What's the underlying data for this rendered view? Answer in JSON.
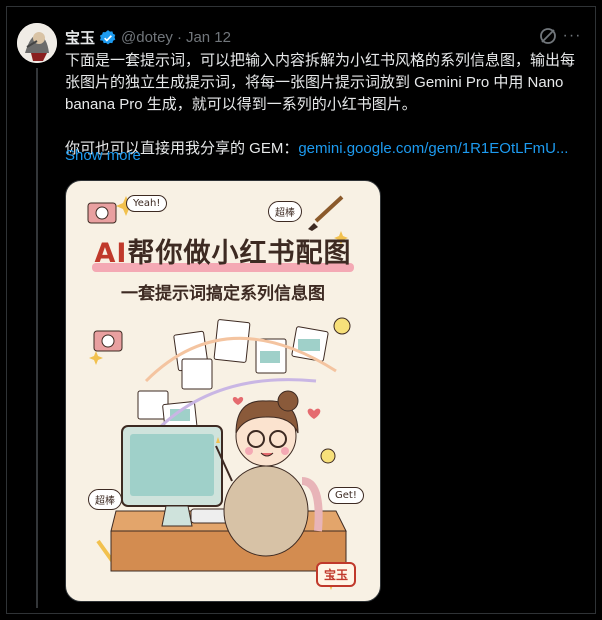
{
  "author": {
    "name": "宝玉",
    "handle": "@dotey",
    "separator": "·",
    "date": "Jan 12"
  },
  "tweet": {
    "para1": "下面是一套提示词，可以把输入内容拆解为小红书风格的系列信息图，输出每张图片的独立生成提示词，将每一张图片提示词放到 Gemini Pro 中用 Nano banana Pro 生成，就可以得到一系列的小红书图片。",
    "para2_prefix": "你可也可以直接用我分享的 GEM：",
    "link": "gemini.google.com/gem/1R1EOtLFmU...",
    "show_more": "Show more"
  },
  "media": {
    "title_ai": "AI",
    "title_rest": "帮你做小红书配图",
    "subtitle": "一套提示词搞定系列信息图",
    "bubble_yeah": "Yeah!",
    "bubble_chaobang_top": "超棒",
    "bubble_chaobang_bottom": "超棒",
    "bubble_get": "Get!",
    "stamp": "宝玉"
  },
  "icons": {
    "verified": "verified-badge-icon",
    "grok": "grok-icon",
    "more": "more-icon"
  },
  "colors": {
    "link": "#1d9bf0",
    "verified": "#1d9bf0",
    "text": "#e7e9ea",
    "muted": "#71767b"
  }
}
